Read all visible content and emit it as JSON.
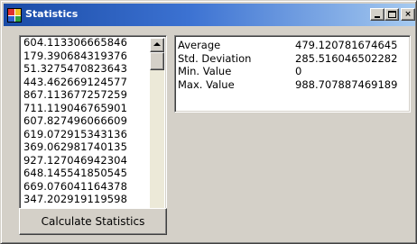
{
  "window": {
    "title": "Statistics",
    "controls": {
      "minimize_icon": "minimize-icon",
      "maximize_icon": "maximize-icon",
      "close_label": "×"
    },
    "colors": {
      "title_start": "#1a4ba6",
      "title_end": "#a6caf0",
      "face": "#d4d0c8"
    }
  },
  "data_list": {
    "items": [
      "604.113306665846",
      "179.390684319376",
      "51.3275470823643",
      "443.462669124577",
      "867.113677257259",
      "711.119046765901",
      "607.827496066609",
      "619.072915343136",
      "369.062981740135",
      "927.127046942304",
      "648.145541850545",
      "669.076041164378",
      "347.202919119598"
    ],
    "scroll_fraction": 0
  },
  "stats": {
    "rows": [
      {
        "label": "Average",
        "value": "479.120781674645"
      },
      {
        "label": "Std. Deviation",
        "value": "285.516046502282"
      },
      {
        "label": "Min. Value",
        "value": "0"
      },
      {
        "label": "Max. Value",
        "value": "988.707887469189"
      }
    ]
  },
  "actions": {
    "calculate_label": "Calculate Statistics"
  }
}
